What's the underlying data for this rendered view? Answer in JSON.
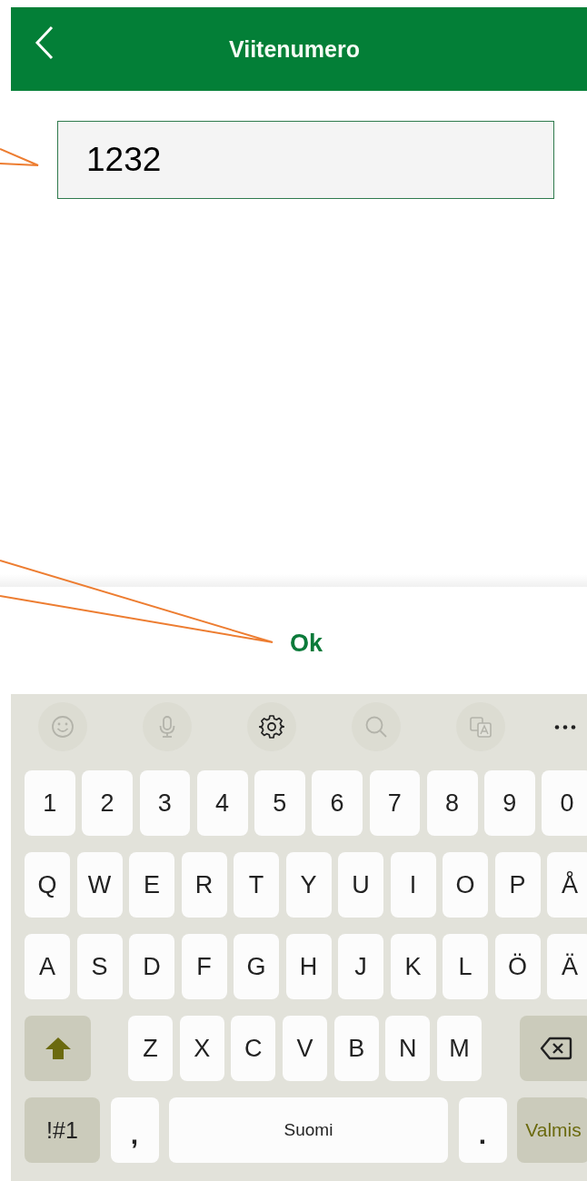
{
  "header": {
    "title": "Viitenumero"
  },
  "field": {
    "value": "1232"
  },
  "ok_button": "Ok",
  "keyboard": {
    "toolbar": [
      {
        "kind": "emoji",
        "disabled": true
      },
      {
        "kind": "voice",
        "disabled": true
      },
      {
        "kind": "settings",
        "disabled": false
      },
      {
        "kind": "search",
        "disabled": true
      },
      {
        "kind": "translate",
        "disabled": true
      },
      {
        "kind": "more",
        "disabled": false
      }
    ],
    "rows": [
      {
        "keys": [
          {
            "kind": "char",
            "label": "1"
          },
          {
            "kind": "char",
            "label": "2"
          },
          {
            "kind": "char",
            "label": "3"
          },
          {
            "kind": "char",
            "label": "4"
          },
          {
            "kind": "char",
            "label": "5"
          },
          {
            "kind": "char",
            "label": "6"
          },
          {
            "kind": "char",
            "label": "7"
          },
          {
            "kind": "char",
            "label": "8"
          },
          {
            "kind": "char",
            "label": "9"
          },
          {
            "kind": "char",
            "label": "0"
          }
        ]
      },
      {
        "keys": [
          {
            "kind": "char",
            "label": "Q"
          },
          {
            "kind": "char",
            "label": "W"
          },
          {
            "kind": "char",
            "label": "E"
          },
          {
            "kind": "char",
            "label": "R"
          },
          {
            "kind": "char",
            "label": "T"
          },
          {
            "kind": "char",
            "label": "Y"
          },
          {
            "kind": "char",
            "label": "U"
          },
          {
            "kind": "char",
            "label": "I"
          },
          {
            "kind": "char",
            "label": "O"
          },
          {
            "kind": "char",
            "label": "P"
          },
          {
            "kind": "char",
            "label": "Å"
          }
        ]
      },
      {
        "keys": [
          {
            "kind": "char",
            "label": "A"
          },
          {
            "kind": "char",
            "label": "S"
          },
          {
            "kind": "char",
            "label": "D"
          },
          {
            "kind": "char",
            "label": "F"
          },
          {
            "kind": "char",
            "label": "G"
          },
          {
            "kind": "char",
            "label": "H"
          },
          {
            "kind": "char",
            "label": "J"
          },
          {
            "kind": "char",
            "label": "K"
          },
          {
            "kind": "char",
            "label": "L"
          },
          {
            "kind": "char",
            "label": "Ö"
          },
          {
            "kind": "char",
            "label": "Ä"
          }
        ]
      },
      {
        "keys": [
          {
            "kind": "shift"
          },
          {
            "kind": "char",
            "label": "Z"
          },
          {
            "kind": "char",
            "label": "X"
          },
          {
            "kind": "char",
            "label": "C"
          },
          {
            "kind": "char",
            "label": "V"
          },
          {
            "kind": "char",
            "label": "B"
          },
          {
            "kind": "char",
            "label": "N"
          },
          {
            "kind": "char",
            "label": "M"
          },
          {
            "kind": "backspace"
          }
        ]
      },
      {
        "keys": [
          {
            "kind": "symbols",
            "label": "!#1"
          },
          {
            "kind": "punct",
            "label": ","
          },
          {
            "kind": "space",
            "label": "Suomi"
          },
          {
            "kind": "punct",
            "label": "."
          },
          {
            "kind": "enter",
            "label": "Valmis"
          }
        ]
      }
    ]
  }
}
